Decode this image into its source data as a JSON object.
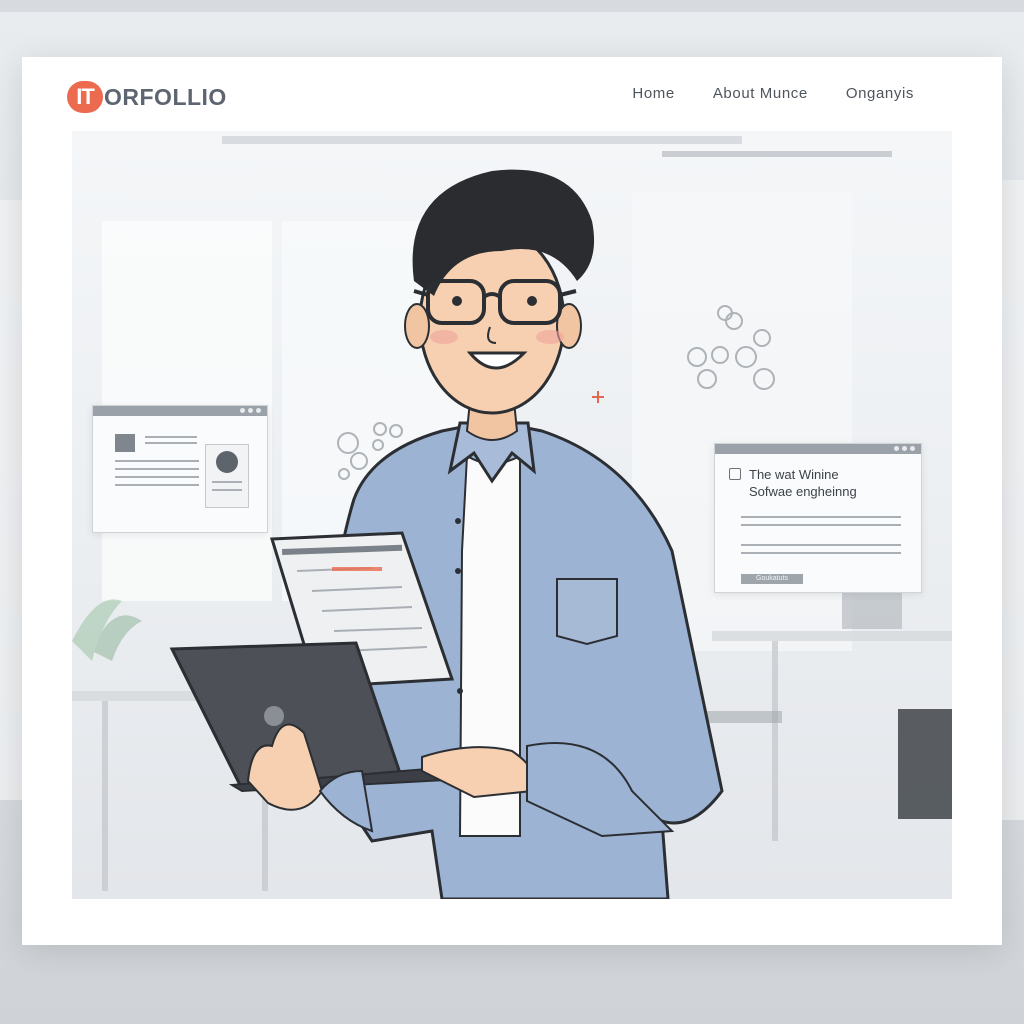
{
  "header": {
    "logo_badge": "IT",
    "logo_text": "ORFOLLIO",
    "nav": [
      {
        "label": "Home"
      },
      {
        "label": "About  Munce"
      },
      {
        "label": "Onganyis"
      }
    ]
  },
  "hero": {
    "right_window": {
      "title_line1": "The wat Winine",
      "title_line2": "Sofwae engheinng",
      "button_label": "Goukatuts"
    }
  },
  "colors": {
    "accent": "#ec6b4f",
    "shirt": "#9db3d3",
    "pants": "#7a5133",
    "laptop": "#4d5157"
  }
}
